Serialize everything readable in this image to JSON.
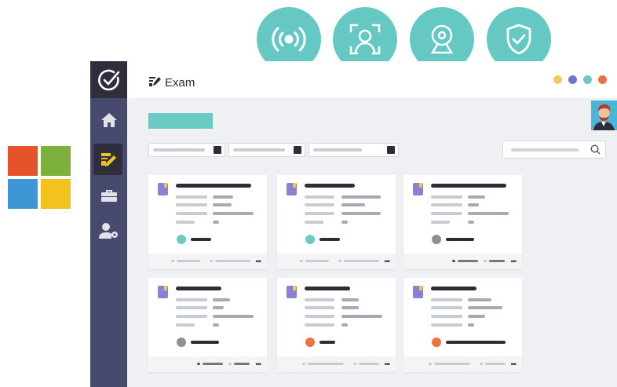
{
  "app": {
    "page_title": "Exam",
    "icons": {
      "brand": "check-circle-logo-icon",
      "page_title": "edit-icon",
      "search": "search-icon"
    },
    "nav": [
      {
        "icon": "home-icon",
        "active": false
      },
      {
        "icon": "exam-edit-icon",
        "active": true
      },
      {
        "icon": "toolbox-icon",
        "active": false
      },
      {
        "icon": "user-settings-icon",
        "active": false
      }
    ],
    "window_dots": [
      "#f4c95d",
      "#7276c8",
      "#6ccac4",
      "#f07041"
    ]
  },
  "features": [
    {
      "icon": "broadcast-icon"
    },
    {
      "icon": "face-recognition-icon"
    },
    {
      "icon": "webcam-icon"
    },
    {
      "icon": "shield-check-icon"
    }
  ],
  "colors": {
    "accent_teal": "#66c8c3",
    "sidebar": "#474a6c",
    "status_ok": "#6ccac4",
    "status_none": "#8c8f98",
    "status_alert": "#f07041"
  },
  "cards": [
    {
      "status": "ok",
      "footer": "meta-views"
    },
    {
      "status": "ok",
      "footer": "meta-views"
    },
    {
      "status": "none",
      "footer": "edit-grid"
    },
    {
      "status": "none",
      "footer": "edit-grid"
    },
    {
      "status": "alert",
      "footer": "doc-bookmark"
    },
    {
      "status": "alert",
      "footer": "doc-bookmark"
    }
  ]
}
